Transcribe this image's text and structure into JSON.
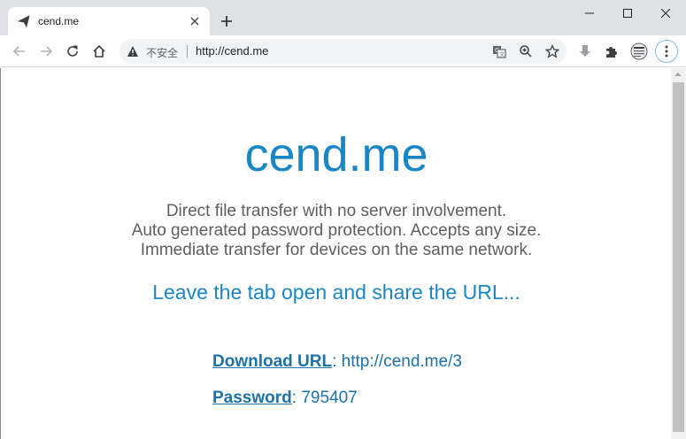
{
  "browser": {
    "tab": {
      "title": "cend.me",
      "favicon": "paper-plane-icon"
    },
    "address_bar": {
      "security_label": "不安全",
      "url": "http://cend.me"
    },
    "icons": {
      "back": "back-arrow-icon",
      "forward": "forward-arrow-icon",
      "reload": "reload-icon",
      "home": "home-icon",
      "translate": "translate-icon",
      "zoom": "zoom-icon",
      "bookmark": "star-icon",
      "download": "download-icon",
      "extensions": "puzzle-icon",
      "extension_page": "extension-page-icon",
      "menu": "kebab-menu-icon"
    }
  },
  "page": {
    "title": "cend.me",
    "description": [
      "Direct file transfer with no server involvement.",
      "Auto generated password protection. Accepts any size.",
      "Immediate transfer for devices on the same network."
    ],
    "call_to_action": "Leave the tab open and share the URL...",
    "download": {
      "label": "Download URL",
      "separator": ":",
      "value": "http://cend.me/3"
    },
    "password": {
      "label": "Password",
      "separator": ":",
      "value": "795407"
    }
  },
  "colors": {
    "accent": "#1a86c6",
    "link": "#1d72aa",
    "body_text": "#5e5e5e",
    "chrome_bg": "#dee1e6"
  }
}
